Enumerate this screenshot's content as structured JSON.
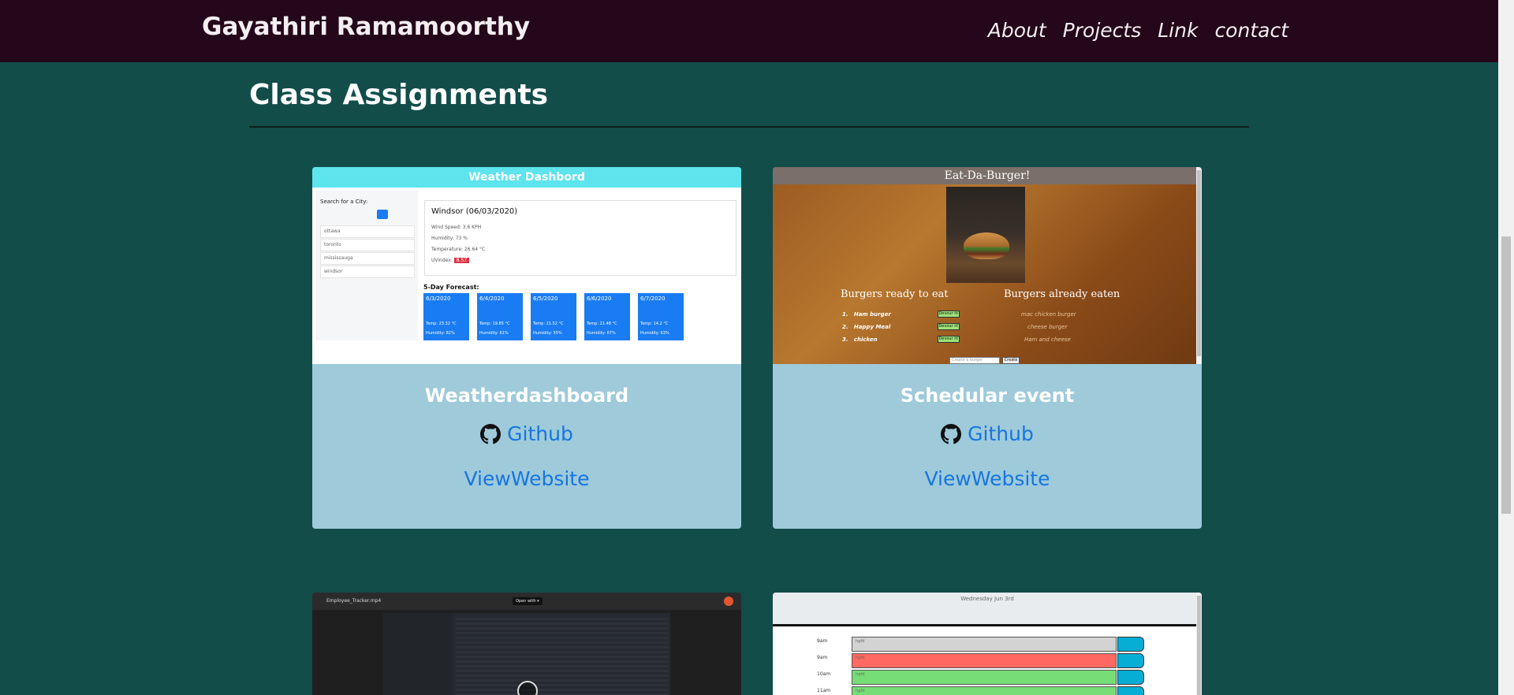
{
  "navbar": {
    "brand": "Gayathiri Ramamoorthy",
    "links": [
      "About",
      "Projects",
      "Link",
      "contact"
    ]
  },
  "section": {
    "title": "Class Assignments"
  },
  "cards": [
    {
      "title": "Weatherdashboard",
      "github_label": "Github",
      "website_label": "ViewWebsite",
      "preview": {
        "header": "Weather Dashbord",
        "search_label": "Search for a City:",
        "cities": [
          "ottawa",
          "toronto",
          "mississauga",
          "windsor"
        ],
        "current_title": "Windsor (06/03/2020)",
        "wind": "Wind Speed: 3.6 KPH",
        "humidity": "Humidity: 73 %",
        "temperature": "Temperature: 26.64 °C",
        "uv_label": "UVindex:",
        "uv_value": "8.57",
        "forecast_label": "5-Day Forecast:",
        "forecast": [
          {
            "date": "6/3/2020",
            "temp": "Temp: 23.32 °C",
            "humidity": "Humidity: 82%"
          },
          {
            "date": "6/4/2020",
            "temp": "Temp: 19.85 °C",
            "humidity": "Humidity: 61%"
          },
          {
            "date": "6/5/2020",
            "temp": "Temp: 21.52 °C",
            "humidity": "Humidity: 55%"
          },
          {
            "date": "6/6/2020",
            "temp": "Temp: 21.48 °C",
            "humidity": "Humidity: 67%"
          },
          {
            "date": "6/7/2020",
            "temp": "Temp: 14.2 °C",
            "humidity": "Humidity: 63%"
          }
        ]
      }
    },
    {
      "title": "Schedular event",
      "github_label": "Github",
      "website_label": "ViewWebsite",
      "preview": {
        "header": "Eat-Da-Burger!",
        "ready_title": "Burgers ready to eat",
        "eaten_title": "Burgers already eaten",
        "ready": [
          "Ham burger",
          "Happy Meal",
          "chicken"
        ],
        "ready_numbers": [
          "1.",
          "2.",
          "3."
        ],
        "devour_label": "Devour it!",
        "eaten": [
          "mac chicken burger",
          "cheese burger",
          "Ham and cheese"
        ],
        "input_placeholder": "Create a burger",
        "create_label": "Create"
      }
    }
  ],
  "bottom_previews": {
    "video": {
      "file_name": "Employee_Tracker.mp4",
      "open_with": "Open with ▾"
    },
    "scheduler": {
      "date": "Wednesday Jun 3rd",
      "hours": [
        "9am",
        "9am",
        "10am",
        "11am"
      ],
      "slot_text": "hgfd",
      "slot_colors": [
        "#d3d3d3",
        "#ff6961",
        "#77dd77",
        "#77dd77"
      ]
    }
  },
  "colors": {
    "page_bg": "#124d4a",
    "navbar_bg": "#24071a",
    "card_bg": "#9ecada",
    "link": "#1675e0"
  },
  "icons": {
    "github": "github-icon"
  }
}
